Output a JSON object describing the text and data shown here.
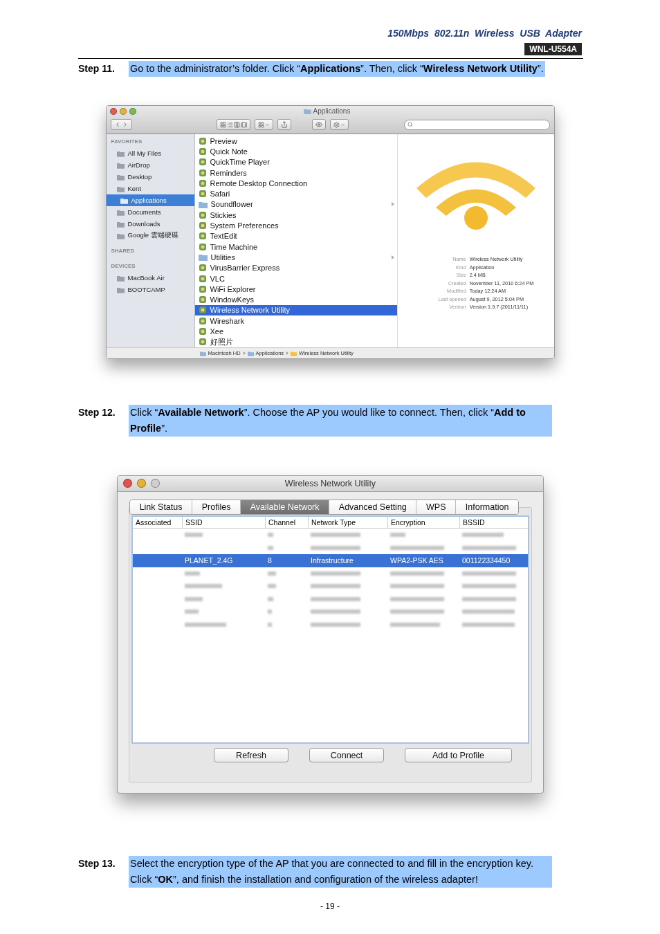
{
  "header": {
    "title": "150Mbps  802.11n  Wireless  USB  Adapter",
    "model": "WNL-U554A"
  },
  "steps": [
    {
      "label": "Step 11.",
      "text": "Go to the administrator’s folder. Click “**Applications**”. Then, click “**Wireless Network Utility**”.",
      "finder": {
        "title": "Applications",
        "sidebar": [
          {
            "heading": "FAVORITES",
            "items": [
              {
                "label": "All My Files",
                "selected": false
              },
              {
                "label": "AirDrop",
                "selected": false
              },
              {
                "label": "Desktop",
                "selected": false
              },
              {
                "label": "Kent",
                "selected": false
              },
              {
                "label": "Applications",
                "selected": true
              },
              {
                "label": "Documents",
                "selected": false
              },
              {
                "label": "Downloads",
                "selected": false
              },
              {
                "label": "Google 雲端硬碟",
                "selected": false
              }
            ]
          },
          {
            "heading": "SHARED"
          },
          {
            "heading": "DEVICES",
            "items": [
              {
                "label": "MacBook Air",
                "selected": false
              },
              {
                "label": "BOOTCAMP",
                "selected": false
              }
            ]
          }
        ],
        "files": [
          {
            "label": "Preview",
            "selected": false,
            "folder": false
          },
          {
            "label": "Quick Note",
            "selected": false,
            "folder": false
          },
          {
            "label": "QuickTime Player",
            "selected": false,
            "folder": false
          },
          {
            "label": "Reminders",
            "selected": false,
            "folder": false
          },
          {
            "label": "Remote Desktop Connection",
            "selected": false,
            "folder": false
          },
          {
            "label": "Safari",
            "selected": false,
            "folder": false
          },
          {
            "label": "Soundflower",
            "selected": false,
            "folder": true
          },
          {
            "label": "Stickies",
            "selected": false,
            "folder": false
          },
          {
            "label": "System Preferences",
            "selected": false,
            "folder": false
          },
          {
            "label": "TextEdit",
            "selected": false,
            "folder": false
          },
          {
            "label": "Time Machine",
            "selected": false,
            "folder": false
          },
          {
            "label": "Utilities",
            "selected": false,
            "folder": true
          },
          {
            "label": "VirusBarrier Express",
            "selected": false,
            "folder": false
          },
          {
            "label": "VLC",
            "selected": false,
            "folder": false
          },
          {
            "label": "WiFi Explorer",
            "selected": false,
            "folder": false
          },
          {
            "label": "WindowKeys",
            "selected": false,
            "folder": false
          },
          {
            "label": "Wireless Network Utility",
            "selected": true,
            "folder": false
          },
          {
            "label": "Wireshark",
            "selected": false,
            "folder": false
          },
          {
            "label": "Xee",
            "selected": false,
            "folder": false
          },
          {
            "label": "好照片",
            "selected": false,
            "folder": false
          }
        ],
        "info": [
          {
            "label": "Name",
            "value": "Wireless Network Utility"
          },
          {
            "label": "Kind",
            "value": "Application"
          },
          {
            "label": "Size",
            "value": "2.4 MB"
          },
          {
            "label": "Created",
            "value": "November 11, 2010 6:24 PM"
          },
          {
            "label": "Modified",
            "value": "Today 12:24 AM"
          },
          {
            "label": "Last opened",
            "value": "August 9, 2012 5:04 PM"
          },
          {
            "label": "Version",
            "value": "Version 1.9.7 (2011/11/11)"
          }
        ],
        "path": [
          "Macintosh HD",
          "Applications",
          "Wireless Network Utility"
        ]
      }
    },
    {
      "label": "Step 12.",
      "text": "Click “**Available Network**”. Choose the AP you would like to connect. Then, click “**Add to Profile**”.",
      "utility": {
        "title": "Wireless Network Utility",
        "tabs": [
          {
            "label": "Link Status",
            "selected": false
          },
          {
            "label": "Profiles",
            "selected": false
          },
          {
            "label": "Available Network",
            "selected": true
          },
          {
            "label": "Advanced Setting",
            "selected": false
          },
          {
            "label": "WPS",
            "selected": false
          },
          {
            "label": "Information",
            "selected": false
          }
        ],
        "columns": [
          "Associated",
          "SSID",
          "Channel",
          "Network Type",
          "Encryption",
          "BSSID"
        ],
        "rows": [
          {
            "blurred": true,
            "selected": false
          },
          {
            "blurred": true,
            "selected": false
          },
          {
            "blurred": false,
            "selected": true,
            "cells": [
              "PLANET_2.4G",
              "8",
              "Infrastructure",
              "WPA2-PSK AES",
              "001122334450"
            ]
          },
          {
            "blurred": true,
            "selected": false
          },
          {
            "blurred": true,
            "selected": false
          },
          {
            "blurred": true,
            "selected": false
          },
          {
            "blurred": true,
            "selected": false
          },
          {
            "blurred": true,
            "selected": false
          }
        ],
        "buttons": [
          "Refresh",
          "Connect",
          "Add to Profile"
        ]
      }
    },
    {
      "label": "Step 13.",
      "text": "Select the encryption type of the AP that you are connected to and fill in the encryption key. Click “**OK**”, and finish the installation and configuration of the wireless adapter!"
    }
  ],
  "page_number": "- 19 -"
}
